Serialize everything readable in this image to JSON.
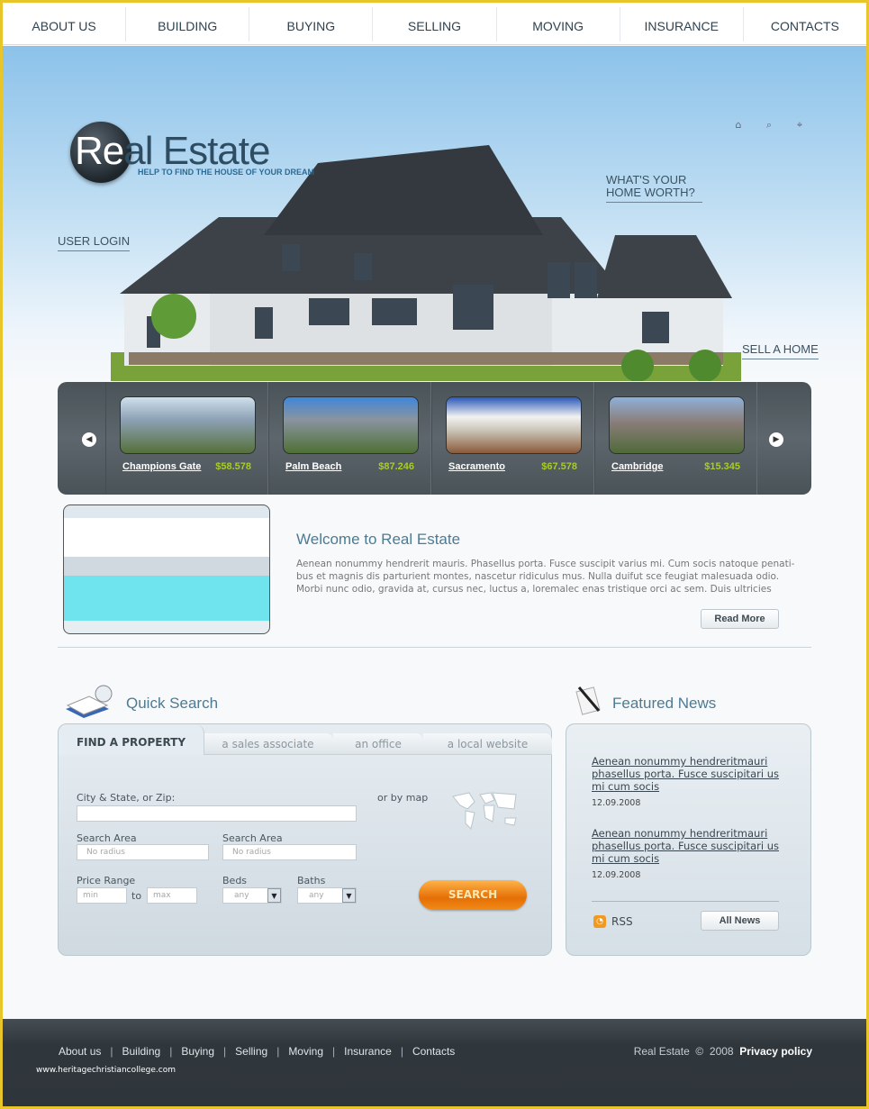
{
  "nav": [
    "ABOUT US",
    "BUILDING",
    "BUYING",
    "SELLING",
    "MOVING",
    "INSURANCE",
    "CONTACTS"
  ],
  "brand": {
    "logo_a": "Re",
    "logo_b": "al Estate",
    "tagline": "HELP TO FIND THE HOUSE OF YOUR DREAM"
  },
  "hero": {
    "user_login": "USER LOGIN",
    "home_worth_1": "WHAT'S YOUR",
    "home_worth_2": "HOME WORTH?",
    "sell_home": "SELL A HOME",
    "icons": [
      "home-icon",
      "search-icon",
      "locate-icon"
    ]
  },
  "listings": [
    {
      "name": "Champions Gate",
      "price": "$58.578"
    },
    {
      "name": "Palm Beach",
      "price": "$87.246"
    },
    {
      "name": "Sacramento",
      "price": "$67.578"
    },
    {
      "name": "Cambridge",
      "price": "$15.345"
    }
  ],
  "welcome": {
    "title": "Welcome to Real Estate",
    "text": "Aenean nonummy hendrerit mauris. Phasellus porta. Fusce suscipit varius mi. Cum socis natoque penati-bus et magnis dis parturient montes, nascetur ridiculus mus. Nulla duifut sce feugiat malesuada odio. Morbi nunc odio, gravida at, cursus nec, luctus a, loremalec enas tristique orci ac sem. Duis ultricies",
    "read_more": "Read More"
  },
  "search": {
    "title": "Quick Search",
    "tabs": [
      "FIND A PROPERTY",
      "a sales associate",
      "an office",
      "a local website"
    ],
    "city_label": "City & State, or Zip:",
    "map_label": "or by map",
    "area_label": "Search Area",
    "area_placeholder": "No radius",
    "price_label": "Price Range",
    "min": "min",
    "to": "to",
    "max": "max",
    "beds_label": "Beds",
    "baths_label": "Baths",
    "any": "any",
    "search_button": "SEARCH"
  },
  "news": {
    "title": "Featured News",
    "items": [
      {
        "title": "Aenean nonummy hendreritmauri phasellus porta. Fusce suscipitari us mi cum socis",
        "date": "12.09.2008"
      },
      {
        "title": "Aenean nonummy hendreritmauri phasellus porta. Fusce suscipitari us mi cum socis",
        "date": "12.09.2008"
      }
    ],
    "rss": "RSS",
    "all_news": "All News"
  },
  "footer": {
    "links": [
      "About us",
      "Building",
      "Buying",
      "Selling",
      "Moving",
      "Insurance",
      "Contacts"
    ],
    "copyright": "Real Estate  ©  2008",
    "privacy": "Privacy policy",
    "watermark": "www.heritagechristiancollege.com"
  },
  "colors": {
    "border": "#e8c62a",
    "accent": "#4d7b93",
    "price": "#a6cc2a",
    "search_button": "#e56f05"
  }
}
